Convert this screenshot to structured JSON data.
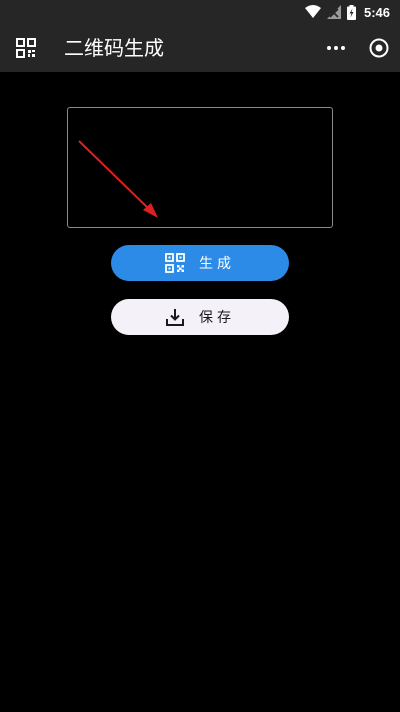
{
  "status_bar": {
    "time": "5:46"
  },
  "app_bar": {
    "title": "二维码生成"
  },
  "input": {
    "value": "",
    "placeholder": ""
  },
  "buttons": {
    "generate_label": "生成",
    "save_label": "保存"
  },
  "colors": {
    "primary": "#2b8be6",
    "save_bg": "#f4f1f8",
    "bar_bg": "#262626",
    "arrow": "#e02020"
  },
  "icons": {
    "nav": "qr-code-icon",
    "more": "more-icon",
    "target": "target-icon",
    "generate": "qr-code-icon",
    "save": "download-icon"
  }
}
